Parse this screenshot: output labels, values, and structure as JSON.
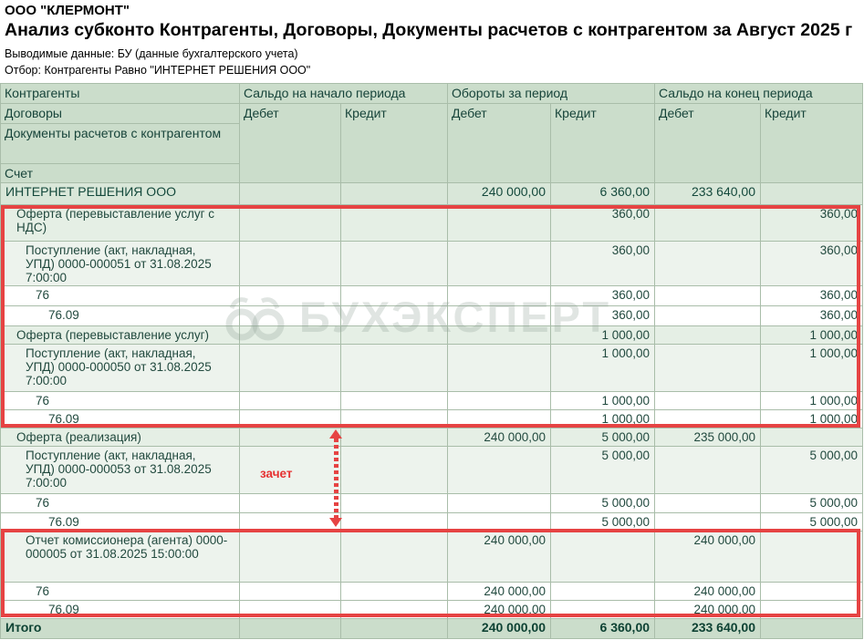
{
  "report": {
    "company": "ООО \"КЛЕРМОНТ\"",
    "title": "Анализ субконто Контрагенты, Договоры, Документы расчетов с контрагентом за Август 2025 г",
    "data_line": "Выводимые данные: БУ (данные бухгалтерского учета)",
    "filter_line": "Отбор: Контрагенты Равно \"ИНТЕРНЕТ РЕШЕНИЯ ООО\""
  },
  "table": {
    "row_headers": [
      "Контрагенты",
      "Договоры",
      "Документы расчетов с контрагентом",
      "Счет"
    ],
    "col_groups": [
      "Сальдо на начало периода",
      "Обороты за период",
      "Сальдо на конец периода"
    ],
    "debit_label": "Дебет",
    "credit_label": "Кредит",
    "rows": [
      {
        "label": "ИНТЕРНЕТ РЕШЕНИЯ ООО",
        "od": "240 000,00",
        "oc": "6 360,00",
        "ed": "233 640,00"
      },
      {
        "label": "Оферта (перевыставление услуг с НДС)",
        "oc": "360,00",
        "ec": "360,00"
      },
      {
        "label": "Поступление (акт, накладная, УПД) 0000-000051 от 31.08.2025 7:00:00",
        "oc": "360,00",
        "ec": "360,00"
      },
      {
        "label": "76",
        "oc": "360,00",
        "ec": "360,00"
      },
      {
        "label": "76.09",
        "oc": "360,00",
        "ec": "360,00"
      },
      {
        "label": "Оферта (перевыставление услуг)",
        "oc": "1 000,00",
        "ec": "1 000,00"
      },
      {
        "label": "Поступление (акт, накладная, УПД) 0000-000050 от 31.08.2025 7:00:00",
        "oc": "1 000,00",
        "ec": "1 000,00"
      },
      {
        "label": "76",
        "oc": "1 000,00",
        "ec": "1 000,00"
      },
      {
        "label": "76.09",
        "oc": "1 000,00",
        "ec": "1 000,00"
      },
      {
        "label": "Оферта (реализация)",
        "od": "240 000,00",
        "oc": "5 000,00",
        "ed": "235 000,00"
      },
      {
        "label": "Поступление (акт, накладная, УПД) 0000-000053 от 31.08.2025 7:00:00",
        "oc": "5 000,00",
        "ec": "5 000,00"
      },
      {
        "label": "76",
        "oc": "5 000,00",
        "ec": "5 000,00"
      },
      {
        "label": "76.09",
        "oc": "5 000,00",
        "ec": "5 000,00"
      },
      {
        "label": "Отчет комиссионера (агента) 0000-000005 от 31.08.2025 15:00:00",
        "od": "240 000,00",
        "ed": "240 000,00"
      },
      {
        "label": "76",
        "od": "240 000,00",
        "ed": "240 000,00"
      },
      {
        "label": "76.09",
        "od": "240 000,00",
        "ed": "240 000,00"
      }
    ],
    "total": {
      "label": "Итого",
      "od": "240 000,00",
      "oc": "6 360,00",
      "ed": "233 640,00"
    }
  },
  "annotations": {
    "offset_label": "зачет",
    "watermark": "БУХЭКСПЕРТ",
    "highlight_color": "#e64343"
  }
}
